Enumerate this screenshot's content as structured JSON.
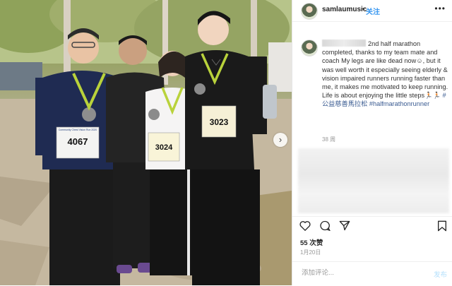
{
  "header": {
    "username": "samlaumusic",
    "separator": "•",
    "follow_label": "关注",
    "more_icon": "more-horizontal-icon"
  },
  "caption": {
    "text": "2nd half marathon completed, thanks to my team mate and coach My legs are like dead now☺, but it was well worth it especially seeing elderly & vision impaired runners running faster than me, it makes me motivated to keep running. Life is about enjoying the little steps",
    "emoji": "🏃🏻🏃🏻",
    "hashtags": [
      "#公益慈善馬拉松",
      "#halfmarathonrunner"
    ]
  },
  "post_time": "38 周",
  "actions": {
    "like_icon": "heart-icon",
    "comment_icon": "comment-bubble-icon",
    "share_icon": "send-icon",
    "save_icon": "bookmark-icon"
  },
  "likes": "55 次赞",
  "date": "1月20日",
  "comment_box": {
    "placeholder": "添加评论...",
    "post_label": "发布"
  },
  "photo": {
    "bibs": [
      "4067",
      "3024",
      "3023"
    ],
    "bib_event_label": "Community Chest Vision Run 2020"
  },
  "colors": {
    "link": "#3897f0",
    "hashtag": "#3a5b91",
    "post_disabled": "#b2dffc"
  }
}
